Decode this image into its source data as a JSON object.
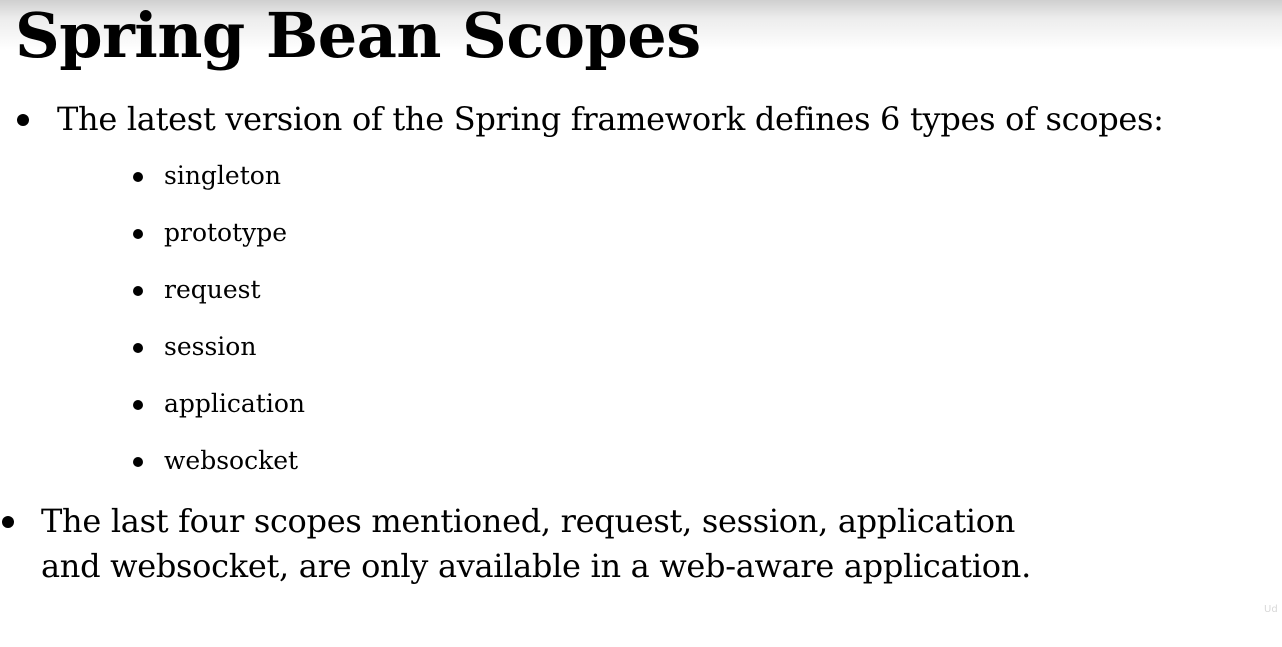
{
  "slide": {
    "title": "Spring Bean Scopes",
    "bullet1": "The latest version of the Spring framework defines 6 types of scopes:",
    "scopes": [
      "singleton",
      "prototype",
      "request",
      "session",
      "application",
      "websocket"
    ],
    "bullet2_line1": "The last four scopes mentioned, request, session, application",
    "bullet2_line2": "and websocket, are only available in a web-aware application.",
    "watermark": "Ud"
  }
}
